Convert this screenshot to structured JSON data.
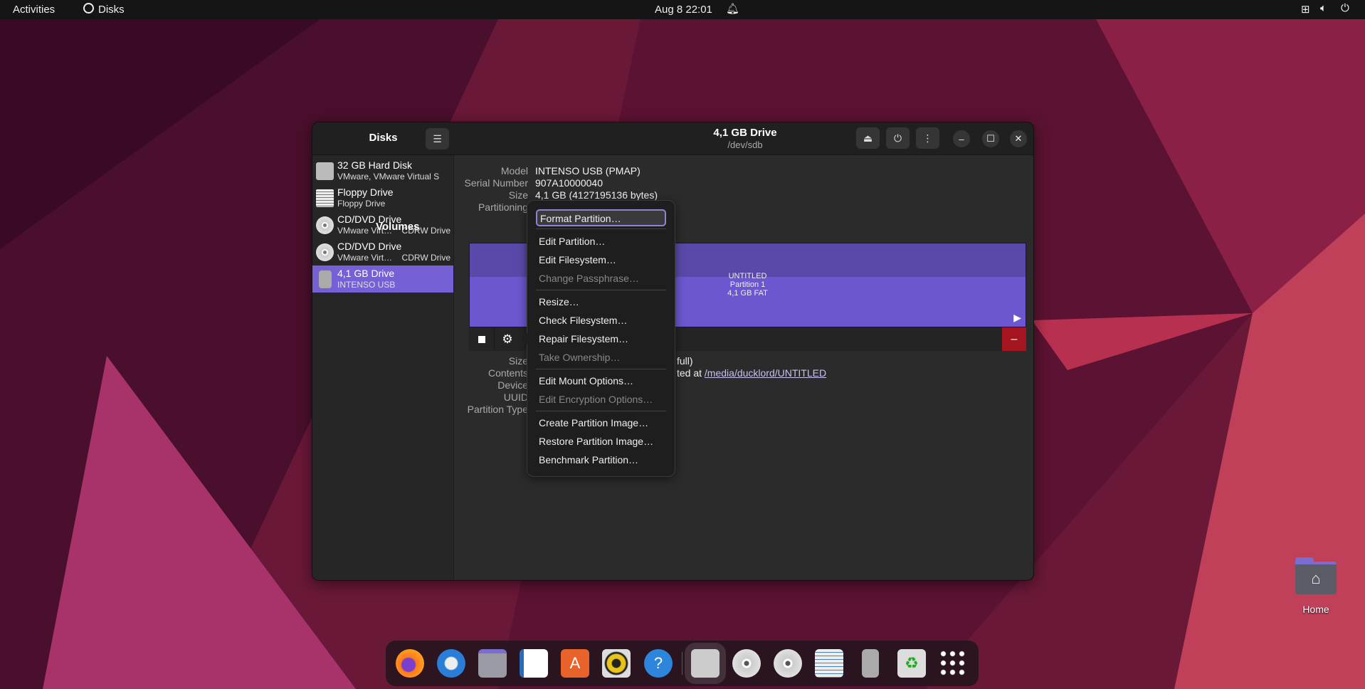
{
  "topbar": {
    "activities": "Activities",
    "app": "Disks",
    "clock": "Aug 8  22:01"
  },
  "sidebar": {
    "title": "Disks",
    "items": [
      {
        "name": "32 GB Hard Disk",
        "sub": "VMware, VMware Virtual S",
        "extra": "",
        "icon": "hard-disk-icon"
      },
      {
        "name": "Floppy Drive",
        "sub": "Floppy Drive",
        "extra": "",
        "icon": "floppy-icon"
      },
      {
        "name": "CD/DVD Drive",
        "sub": "VMware Virt…",
        "extra": "CDRW Drive",
        "icon": "optical-disc-icon"
      },
      {
        "name": "CD/DVD Drive",
        "sub": "VMware Virt…",
        "extra": "CDRW Drive",
        "icon": "optical-disc-icon"
      },
      {
        "name": "4,1 GB Drive",
        "sub": "INTENSO USB",
        "extra": "",
        "icon": "usb-drive-icon",
        "selected": true
      }
    ]
  },
  "header": {
    "title": "4,1 GB Drive",
    "subtitle": "/dev/sdb"
  },
  "drive": {
    "labels": [
      "Model",
      "Serial Number",
      "Size",
      "Partitioning"
    ],
    "values": [
      "INTENSO USB (PMAP)",
      "907A10000040",
      "4,1 GB (4127195136 bytes)",
      ""
    ]
  },
  "volumes": {
    "heading": "Volumes",
    "partition_name": "UNTITLED",
    "partition_number": "Partition 1",
    "partition_size": "4,1 GB FAT",
    "accent": "#7760d6"
  },
  "volume_info": {
    "labels": [
      "Size",
      "Contents",
      "Device",
      "UUID",
      "Partition Type"
    ],
    "size_tail": "full)",
    "contents_tail": "ted at",
    "mount_link": "/media/ducklord/UNTITLED"
  },
  "menu": {
    "items": [
      {
        "label": "Format Partition…",
        "enabled": true
      },
      {
        "label": "Edit Partition…",
        "enabled": true
      },
      {
        "label": "Edit Filesystem…",
        "enabled": true
      },
      {
        "label": "Change Passphrase…",
        "enabled": false
      },
      {
        "label": "Resize…",
        "enabled": true
      },
      {
        "label": "Check Filesystem…",
        "enabled": true
      },
      {
        "label": "Repair Filesystem…",
        "enabled": true
      },
      {
        "label": "Take Ownership…",
        "enabled": false
      },
      {
        "label": "Edit Mount Options…",
        "enabled": true
      },
      {
        "label": "Edit Encryption Options…",
        "enabled": false
      },
      {
        "label": "Create Partition Image…",
        "enabled": true
      },
      {
        "label": "Restore Partition Image…",
        "enabled": true
      },
      {
        "label": "Benchmark Partition…",
        "enabled": true
      }
    ]
  },
  "desktop": {
    "home_label": "Home"
  },
  "dock": [
    "firefox-icon",
    "thunderbird-icon",
    "files-icon",
    "libreoffice-writer-icon",
    "app-center-icon",
    "rhythmbox-icon",
    "help-icon",
    "disks-icon",
    "cd-drive-icon",
    "cd-drive-icon",
    "floppy-icon",
    "usb-drive-icon",
    "trash-icon",
    "app-grid-icon"
  ]
}
